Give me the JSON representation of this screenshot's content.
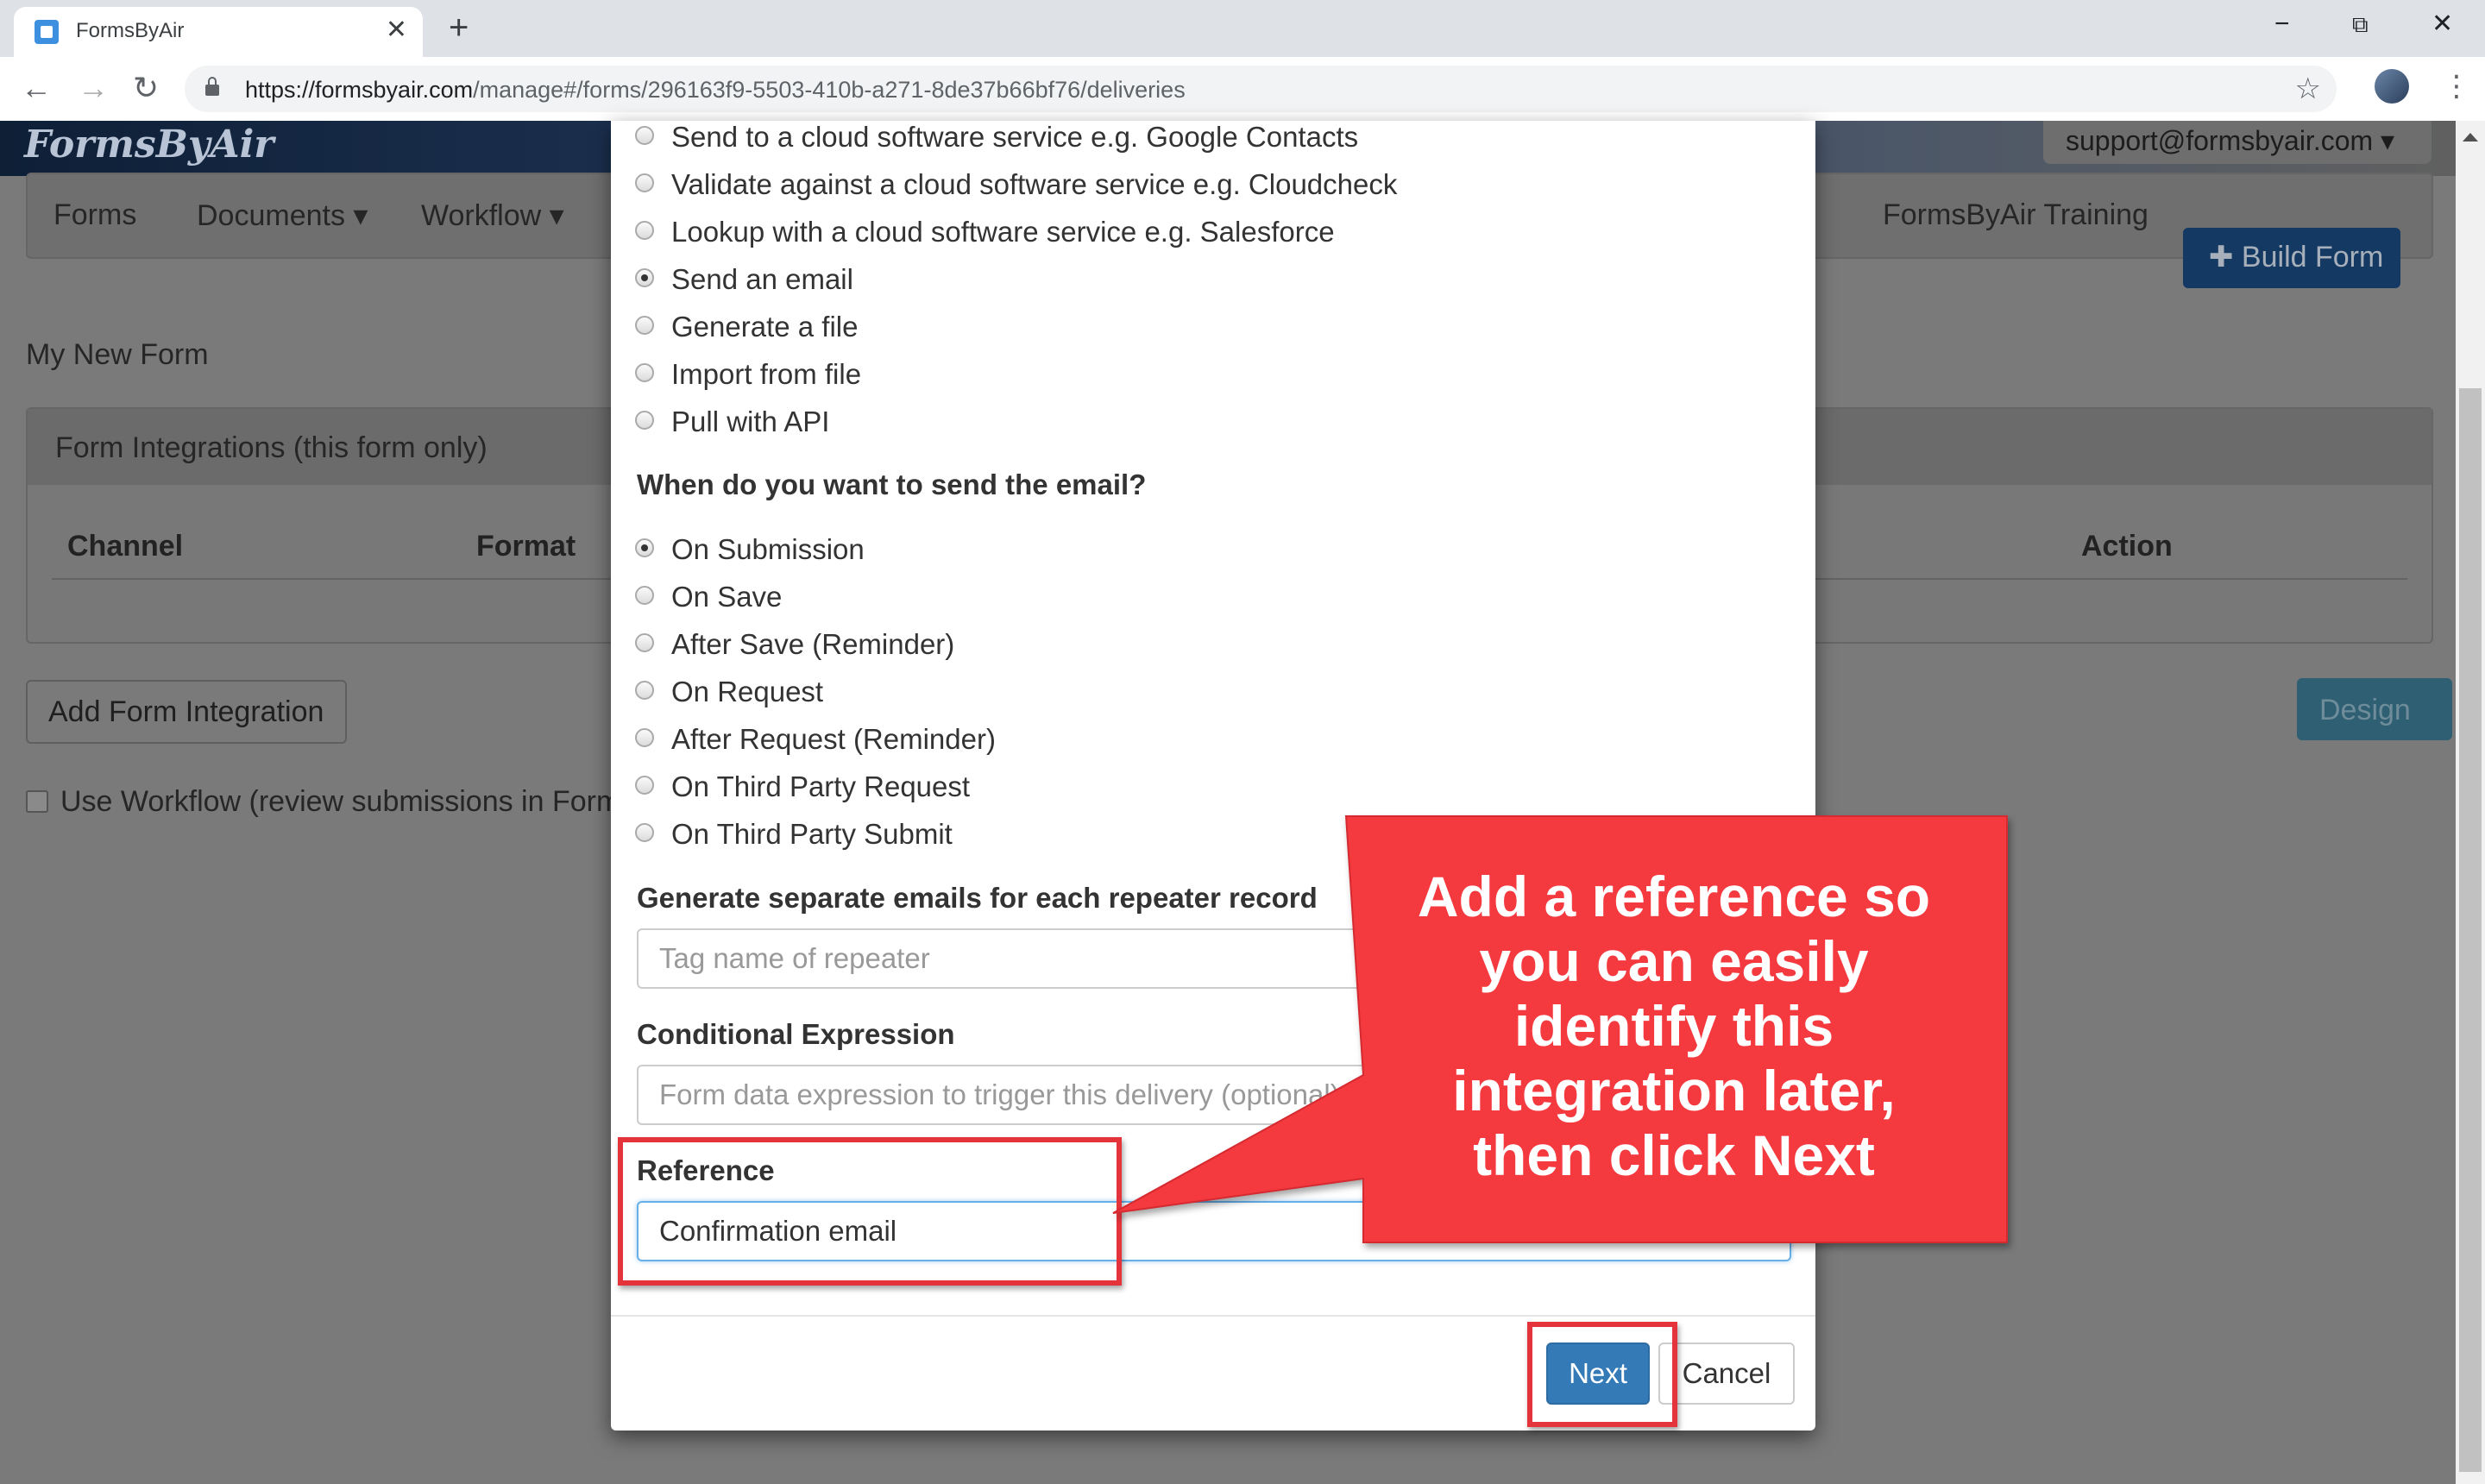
{
  "browser": {
    "tab_title": "FormsByAir",
    "tab_close": "✕",
    "new_tab": "+",
    "url_host": "https://formsbyair.com",
    "url_path": "/manage#/forms/296163f9-5503-410b-a271-8de37b66bf76/deliveries",
    "window_controls": {
      "minimize": "−",
      "restore": "⧉",
      "close": "✕"
    },
    "nav": {
      "back": "←",
      "forward": "→",
      "reload": "↻"
    },
    "star_icon": "☆",
    "menu_icon": "⋮"
  },
  "site": {
    "logo": "FormsByAir",
    "account": "support@formsbyair.com ▾",
    "nav_items": [
      "Forms",
      "Documents ▾",
      "Workflow ▾",
      "FormsByAir Training"
    ],
    "build_form": "✚ Build Form",
    "page_heading": "My New Form",
    "panel_title": "Form Integrations (this form only)",
    "table_headers": [
      "Channel",
      "Format",
      "Action"
    ],
    "add_integration": "Add Form Integration",
    "design": "Design",
    "workflow_label": "Use Workflow (review submissions in Form"
  },
  "modal": {
    "type_options": [
      {
        "label": "Send to a cloud software service e.g. Google Contacts",
        "checked": false
      },
      {
        "label": "Validate against a cloud software service e.g. Cloudcheck",
        "checked": false
      },
      {
        "label": "Lookup with a cloud software service e.g. Salesforce",
        "checked": false
      },
      {
        "label": "Send an email",
        "checked": true
      },
      {
        "label": "Generate a file",
        "checked": false
      },
      {
        "label": "Import from file",
        "checked": false
      },
      {
        "label": "Pull with API",
        "checked": false
      }
    ],
    "when_label": "When do you want to send the email?",
    "when_options": [
      {
        "label": "On Submission",
        "checked": true
      },
      {
        "label": "On Save",
        "checked": false
      },
      {
        "label": "After Save (Reminder)",
        "checked": false
      },
      {
        "label": "On Request",
        "checked": false
      },
      {
        "label": "After Request (Reminder)",
        "checked": false
      },
      {
        "label": "On Third Party Request",
        "checked": false
      },
      {
        "label": "On Third Party Submit",
        "checked": false
      }
    ],
    "repeater_label": "Generate separate emails for each repeater record",
    "repeater_placeholder": "Tag name of repeater",
    "condition_label": "Conditional Expression",
    "condition_placeholder": "Form data expression to trigger this delivery (optional)",
    "reference_label": "Reference",
    "reference_value": "Confirmation email",
    "next": "Next",
    "cancel": "Cancel"
  },
  "annotation": {
    "callout_lines": [
      "Add a reference so",
      "you can easily",
      "identify this",
      "integration later,",
      "then click Next"
    ],
    "accent_color": "#f4393f"
  }
}
